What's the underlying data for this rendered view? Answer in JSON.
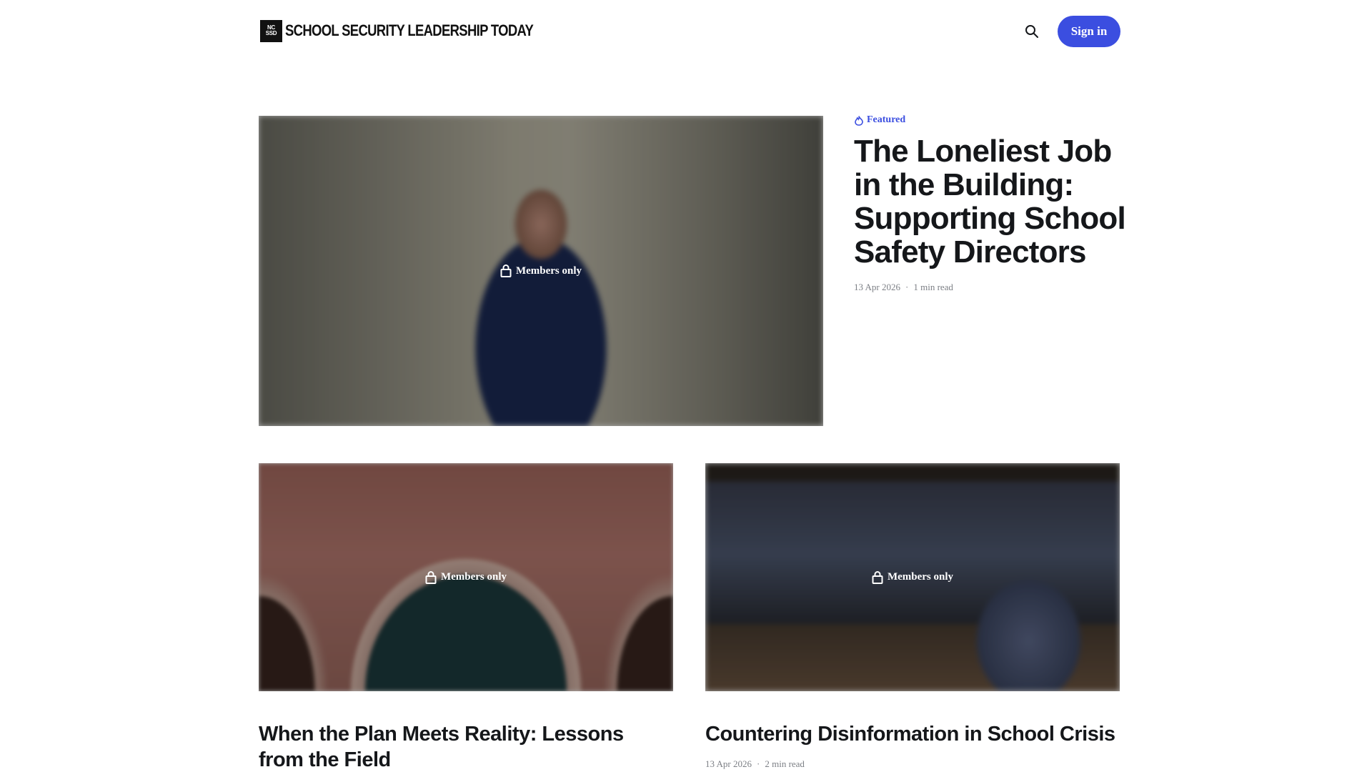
{
  "header": {
    "logo_mark_top": "NC",
    "logo_mark_bottom": "SSD",
    "site_title": "SCHOOL SECURITY LEADERSHIP TODAY",
    "search_icon": "search-icon",
    "signin_label": "Sign in",
    "accent_color": "#3b4ee0"
  },
  "featured": {
    "label": "Featured",
    "icon": "flame-icon",
    "title": "The Loneliest Job in the Building: Supporting School Safety Directors",
    "date": "13 Apr 2026",
    "read_time": "1 min read",
    "badge": "Members only"
  },
  "posts": [
    {
      "title": "When the Plan Meets Reality: Lessons from the Field",
      "badge": "Members only"
    },
    {
      "title": "Countering Disinformation in School Crisis",
      "date": "13 Apr 2026",
      "read_time": "2 min read",
      "badge": "Members only"
    }
  ]
}
